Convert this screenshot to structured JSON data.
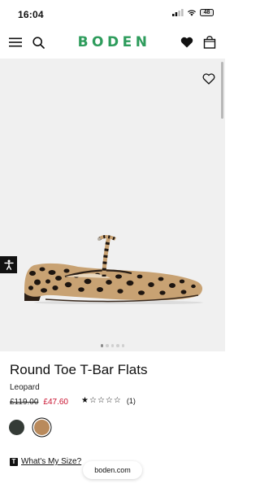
{
  "status_bar": {
    "time": "16:04",
    "battery": "48"
  },
  "header": {
    "logo": "BODEN"
  },
  "gallery": {
    "image_count": 5,
    "active_index": 0
  },
  "product": {
    "title": "Round Toe T-Bar Flats",
    "color": "Leopard",
    "old_price": "£119.00",
    "sale_price": "£47.60",
    "rating": 1,
    "rating_max": 5,
    "review_count": "(1)"
  },
  "swatches": [
    {
      "name": "dark-green",
      "color": "#343b36",
      "selected": false
    },
    {
      "name": "leopard",
      "color": "#b98a5c",
      "selected": true
    }
  ],
  "size_guide": {
    "icon": "T",
    "label": "What's My Size?"
  },
  "browser": {
    "url": "boden.com"
  },
  "colors": {
    "brand": "#2e9c5c",
    "sale": "#c8102e"
  }
}
